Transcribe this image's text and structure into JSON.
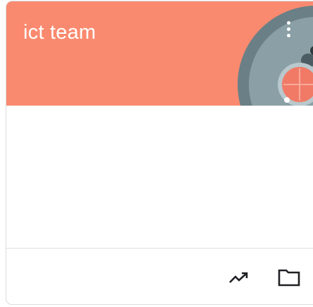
{
  "class_card": {
    "title": "ict team",
    "banner_color": "#fa8a6f",
    "icons": {
      "more": "more-vert-icon",
      "trend": "trending-up-icon",
      "folder": "folder-icon"
    }
  }
}
